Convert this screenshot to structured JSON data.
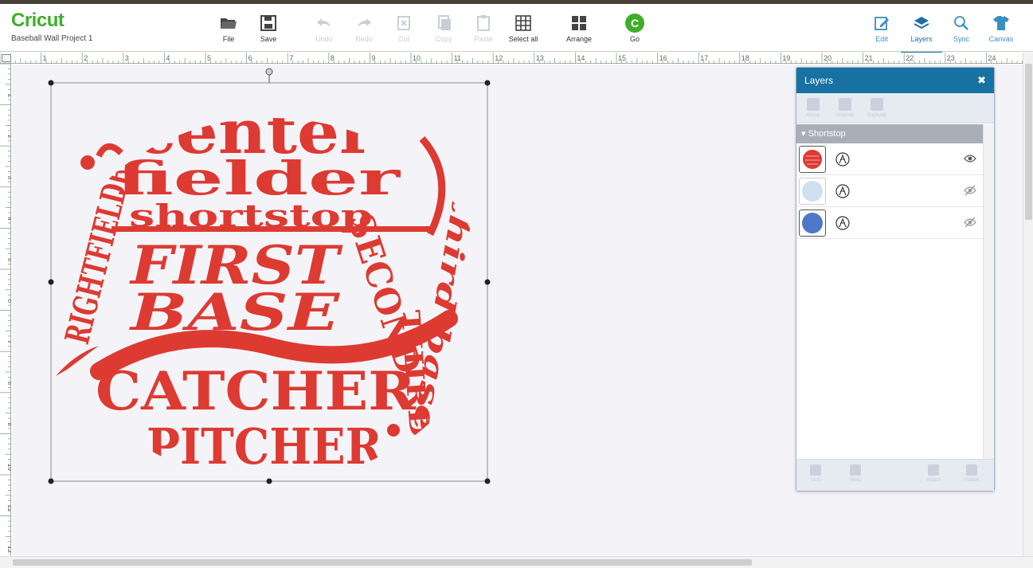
{
  "app": {
    "logo": "Cricut",
    "project_name": "Baseball Wall Project 1"
  },
  "toolbar": {
    "file": "File",
    "save": "Save",
    "undo": "Undo",
    "redo": "Redo",
    "cut": "Cut",
    "copy": "Copy",
    "paste": "Paste",
    "select_all": "Select all",
    "arrange": "Arrange",
    "go": "Go",
    "go_glyph": "C"
  },
  "right_tabs": {
    "edit": "Edit",
    "layers": "Layers",
    "sync": "Sync",
    "canvas": "Canvas"
  },
  "ruler": {
    "top": [
      "1",
      "2",
      "3",
      "4",
      "5",
      "6",
      "7",
      "8",
      "9",
      "10",
      "11",
      "12",
      "13",
      "14",
      "15",
      "16",
      "17",
      "18",
      "19",
      "20",
      "21",
      "22",
      "23",
      "24"
    ],
    "left": [
      "1",
      "2",
      "3",
      "4",
      "5",
      "6",
      "7",
      "8",
      "9",
      "10",
      "11",
      "12"
    ]
  },
  "design": {
    "fill": "#dd3a32",
    "words": {
      "w1": "center",
      "w2": "fielder",
      "w3": "shortstop",
      "w4": "FIRST",
      "w5": "BASE",
      "w6": "CATCHER",
      "w7": "PITCHER",
      "w8": "RIGHTFIELDER",
      "w9": "SECOND",
      "w10": "third base",
      "w11": "THIRD"
    }
  },
  "layers_panel": {
    "title": "Layers",
    "close_glyph": "✖",
    "tools": [
      "Group",
      "Ungroup",
      "Duplicate"
    ],
    "group_name": "Shortstop",
    "rows": [
      {
        "swatch": "#dd3a32",
        "visible": true
      },
      {
        "swatch": "#cfe0f2",
        "visible": false
      },
      {
        "swatch": "#4e77c6",
        "visible": false
      }
    ],
    "footer": [
      "Slice",
      "Weld",
      "Attach",
      "Flatten"
    ]
  }
}
